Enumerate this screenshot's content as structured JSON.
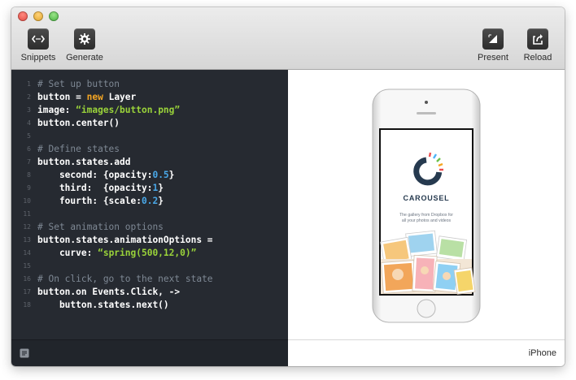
{
  "toolbar": {
    "left": [
      {
        "label": "Snippets",
        "icon": "code-brackets-icon"
      },
      {
        "label": "Generate",
        "icon": "gear-icon"
      }
    ],
    "right": [
      {
        "label": "Present",
        "icon": "expand-corner-icon"
      },
      {
        "label": "Reload",
        "icon": "reload-share-icon"
      }
    ]
  },
  "editor": {
    "lines": [
      {
        "n": "1",
        "parts": [
          {
            "t": "# Set up button",
            "c": "cm"
          }
        ]
      },
      {
        "n": "2",
        "parts": [
          {
            "t": "button = ",
            "c": ""
          },
          {
            "t": "new",
            "c": "kw"
          },
          {
            "t": " Layer",
            "c": ""
          }
        ]
      },
      {
        "n": "3",
        "parts": [
          {
            "t": "image: ",
            "c": ""
          },
          {
            "t": "“images/button.png”",
            "c": "str"
          }
        ]
      },
      {
        "n": "4",
        "parts": [
          {
            "t": "button.center()",
            "c": ""
          }
        ]
      },
      {
        "n": "5",
        "parts": []
      },
      {
        "n": "6",
        "parts": [
          {
            "t": "# Define states",
            "c": "cm"
          }
        ]
      },
      {
        "n": "7",
        "parts": [
          {
            "t": "button.states.add",
            "c": ""
          }
        ]
      },
      {
        "n": "8",
        "parts": [
          {
            "t": "    second: {opacity:",
            "c": ""
          },
          {
            "t": "0.5",
            "c": "num"
          },
          {
            "t": "}",
            "c": ""
          }
        ]
      },
      {
        "n": "9",
        "parts": [
          {
            "t": "    third:  {opacity:",
            "c": ""
          },
          {
            "t": "1",
            "c": "num"
          },
          {
            "t": "}",
            "c": ""
          }
        ]
      },
      {
        "n": "10",
        "parts": [
          {
            "t": "    fourth: {scale:",
            "c": ""
          },
          {
            "t": "0.2",
            "c": "num"
          },
          {
            "t": "}",
            "c": ""
          }
        ]
      },
      {
        "n": "11",
        "parts": []
      },
      {
        "n": "12",
        "parts": [
          {
            "t": "# Set animation options",
            "c": "cm"
          }
        ]
      },
      {
        "n": "13",
        "parts": [
          {
            "t": "button.states.animationOptions =",
            "c": ""
          }
        ]
      },
      {
        "n": "14",
        "parts": [
          {
            "t": "    curve: ",
            "c": ""
          },
          {
            "t": "“spring(500,12,0)”",
            "c": "str"
          }
        ]
      },
      {
        "n": "15",
        "parts": []
      },
      {
        "n": "16",
        "parts": [
          {
            "t": "# On click, go to the next state",
            "c": "cm"
          }
        ]
      },
      {
        "n": "17",
        "parts": [
          {
            "t": "button.on Events.Click, ->",
            "c": ""
          }
        ]
      },
      {
        "n": "18",
        "parts": [
          {
            "t": "    button.states.next()",
            "c": ""
          }
        ]
      }
    ]
  },
  "preview": {
    "device_label": "iPhone",
    "app_title": "CAROUSEL",
    "app_tagline_1": "The gallery from Dropbox for",
    "app_tagline_2": "all your photos and videos"
  },
  "colors": {
    "editor_bg": "#262a31",
    "comment": "#7e8894",
    "keyword": "#f5a623",
    "string": "#9ad33a",
    "number": "#4aa8e8"
  }
}
